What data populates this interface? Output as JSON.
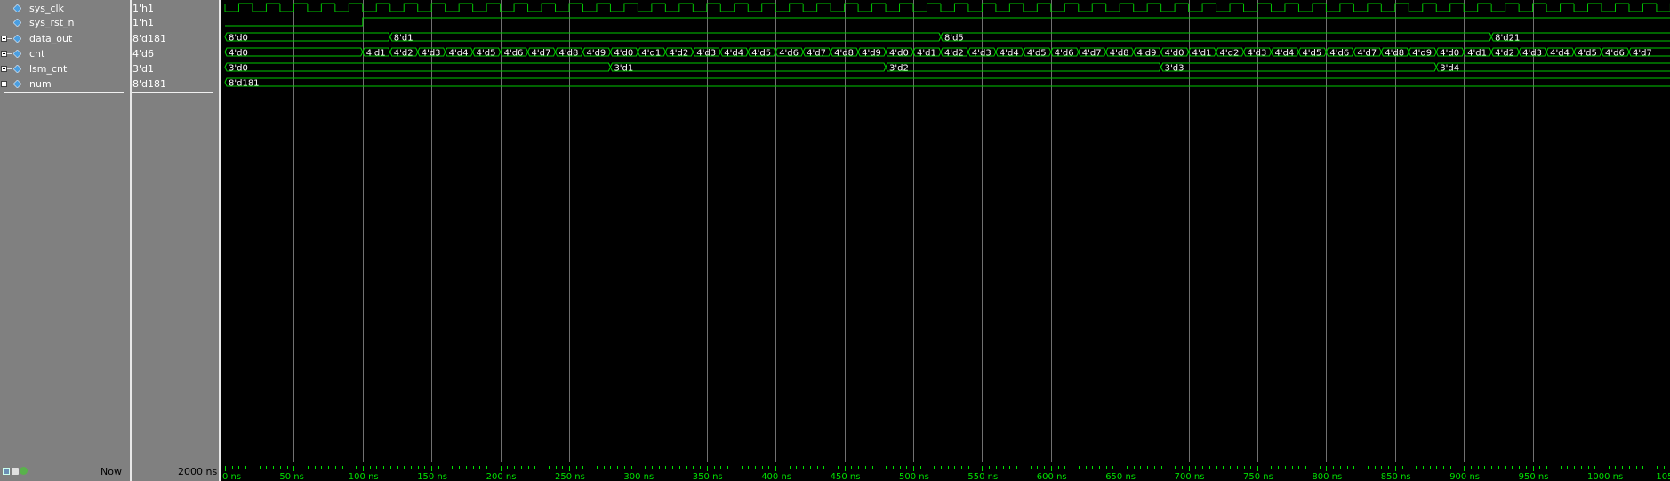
{
  "signals": [
    {
      "id": "sys_clk",
      "name": "sys_clk",
      "value": "1'h1",
      "expandable": false
    },
    {
      "id": "sys_rst_n",
      "name": "sys_rst_n",
      "value": "1'h1",
      "expandable": false
    },
    {
      "id": "data_out",
      "name": "data_out",
      "value": "8'd181",
      "expandable": true
    },
    {
      "id": "cnt",
      "name": "cnt",
      "value": "4'd6",
      "expandable": true
    },
    {
      "id": "lsm_cnt",
      "name": "lsm_cnt",
      "value": "3'd1",
      "expandable": true
    },
    {
      "id": "num",
      "name": "num",
      "value": "8'd181",
      "expandable": true
    }
  ],
  "status": {
    "now_label": "Now",
    "now_value": "2000 ns"
  },
  "timeline": {
    "unit": "ns",
    "start": 0,
    "end": 1050,
    "major_step": 50,
    "minor_step": 5,
    "labels": [
      "0 ns",
      "50 ns",
      "100 ns",
      "150 ns",
      "200 ns",
      "250 ns",
      "300 ns",
      "350 ns",
      "400 ns",
      "450 ns",
      "500 ns",
      "550 ns",
      "600 ns",
      "650 ns",
      "700 ns",
      "750 ns",
      "800 ns",
      "850 ns",
      "900 ns",
      "950 ns",
      "1000 ns",
      "105"
    ]
  },
  "waveforms": {
    "clock_period_ns": 20,
    "reset_release_ns": 100,
    "data_out": [
      {
        "t": 0,
        "label": "8'd0"
      },
      {
        "t": 120,
        "label": "8'd1"
      },
      {
        "t": 520,
        "label": "8'd5"
      },
      {
        "t": 920,
        "label": "8'd21"
      }
    ],
    "cnt": [
      {
        "t": 0,
        "label": "4'd0"
      },
      {
        "t": 100,
        "label": "4'd1"
      },
      {
        "t": 120,
        "label": "4'd2"
      },
      {
        "t": 140,
        "label": "4'd3"
      },
      {
        "t": 160,
        "label": "4'd4"
      },
      {
        "t": 180,
        "label": "4'd5"
      },
      {
        "t": 200,
        "label": "4'd6"
      },
      {
        "t": 220,
        "label": "4'd7"
      },
      {
        "t": 240,
        "label": "4'd8"
      },
      {
        "t": 260,
        "label": "4'd9"
      },
      {
        "t": 280,
        "label": "4'd0"
      },
      {
        "t": 300,
        "label": "4'd1"
      },
      {
        "t": 320,
        "label": "4'd2"
      },
      {
        "t": 340,
        "label": "4'd3"
      },
      {
        "t": 360,
        "label": "4'd4"
      },
      {
        "t": 380,
        "label": "4'd5"
      },
      {
        "t": 400,
        "label": "4'd6"
      },
      {
        "t": 420,
        "label": "4'd7"
      },
      {
        "t": 440,
        "label": "4'd8"
      },
      {
        "t": 460,
        "label": "4'd9"
      },
      {
        "t": 480,
        "label": "4'd0"
      },
      {
        "t": 500,
        "label": "4'd1"
      },
      {
        "t": 520,
        "label": "4'd2"
      },
      {
        "t": 540,
        "label": "4'd3"
      },
      {
        "t": 560,
        "label": "4'd4"
      },
      {
        "t": 580,
        "label": "4'd5"
      },
      {
        "t": 600,
        "label": "4'd6"
      },
      {
        "t": 620,
        "label": "4'd7"
      },
      {
        "t": 640,
        "label": "4'd8"
      },
      {
        "t": 660,
        "label": "4'd9"
      },
      {
        "t": 680,
        "label": "4'd0"
      },
      {
        "t": 700,
        "label": "4'd1"
      },
      {
        "t": 720,
        "label": "4'd2"
      },
      {
        "t": 740,
        "label": "4'd3"
      },
      {
        "t": 760,
        "label": "4'd4"
      },
      {
        "t": 780,
        "label": "4'd5"
      },
      {
        "t": 800,
        "label": "4'd6"
      },
      {
        "t": 820,
        "label": "4'd7"
      },
      {
        "t": 840,
        "label": "4'd8"
      },
      {
        "t": 860,
        "label": "4'd9"
      },
      {
        "t": 880,
        "label": "4'd0"
      },
      {
        "t": 900,
        "label": "4'd1"
      },
      {
        "t": 920,
        "label": "4'd2"
      },
      {
        "t": 940,
        "label": "4'd3"
      },
      {
        "t": 960,
        "label": "4'd4"
      },
      {
        "t": 980,
        "label": "4'd5"
      },
      {
        "t": 1000,
        "label": "4'd6"
      },
      {
        "t": 1020,
        "label": "4'd7"
      }
    ],
    "lsm_cnt": [
      {
        "t": 0,
        "label": "3'd0"
      },
      {
        "t": 280,
        "label": "3'd1"
      },
      {
        "t": 480,
        "label": "3'd2"
      },
      {
        "t": 680,
        "label": "3'd3"
      },
      {
        "t": 880,
        "label": "3'd4"
      }
    ],
    "num": [
      {
        "t": 0,
        "label": "8'd181"
      }
    ]
  },
  "colors": {
    "wave": "#00c800",
    "grid": "#707070",
    "timeline_text": "#00e000",
    "wave_bg": "#000000",
    "panel_bg": "#808080"
  }
}
